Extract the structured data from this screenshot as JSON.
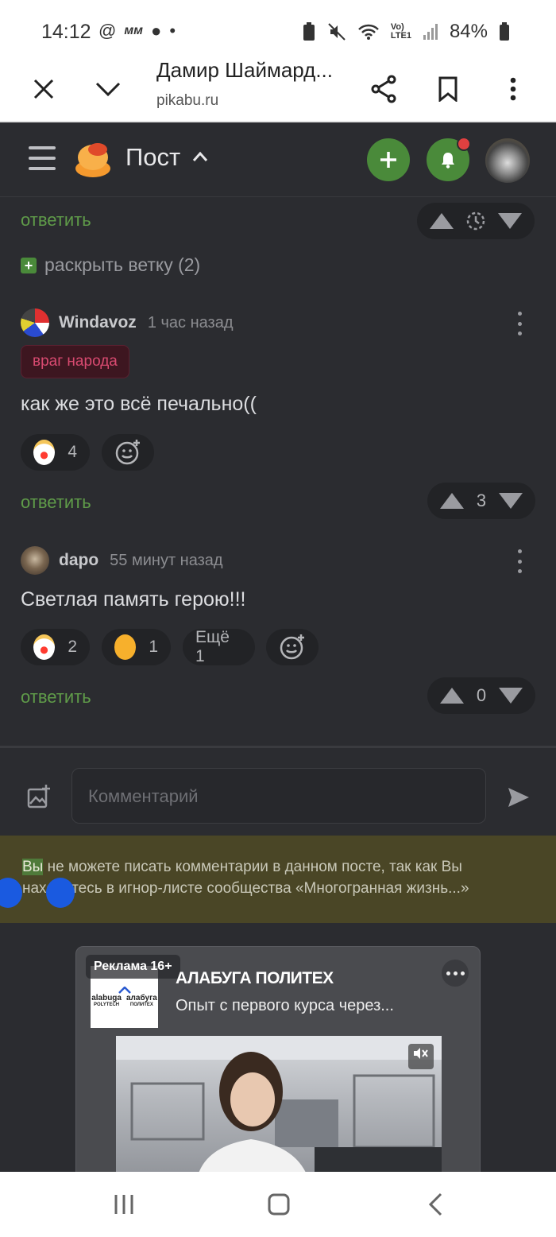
{
  "status_bar": {
    "time": "14:12",
    "battery": "84%",
    "left_icons": [
      "@",
      "ᴍᴍ",
      "●",
      "•"
    ]
  },
  "browser": {
    "title": "Дамир Шаймард...",
    "url": "pikabu.ru"
  },
  "app_header": {
    "title": "Пост"
  },
  "top": {
    "reply_label": "ответить",
    "expand_label": "раскрыть ветку (2)"
  },
  "comments": [
    {
      "author": "Windavoz",
      "time": "1 час назад",
      "badge": "враг народа",
      "text": "как же это всё печально((",
      "reactions": [
        {
          "emoji": "clown",
          "count": "4"
        }
      ],
      "reply_label": "ответить",
      "rating": "3"
    },
    {
      "author": "dapo",
      "time": "55 минут назад",
      "text": "Светлая память герою!!!",
      "reactions": [
        {
          "emoji": "clown",
          "count": "2"
        },
        {
          "emoji": "facepalm",
          "count": "1"
        }
      ],
      "more_label": "Ещё 1",
      "reply_label": "ответить",
      "rating": "0"
    }
  ],
  "composer": {
    "placeholder": "Комментарий"
  },
  "notice": {
    "highlight": "Вы",
    "text": " не можете писать комментарии в данном посте, так как Вы находитесь в игнор-листе сообщества «Многогранная жизнь...»"
  },
  "ad": {
    "label": "Реклама 16+",
    "brand": "АЛАБУГА ПОЛИТЕХ",
    "subtitle": "Опыт с первого курса через...",
    "logo_text_left": "alabuga",
    "logo_text_left2": "POLYTECH",
    "logo_text_right": "алабуга",
    "logo_text_right2": "ПОЛИТЕХ"
  }
}
